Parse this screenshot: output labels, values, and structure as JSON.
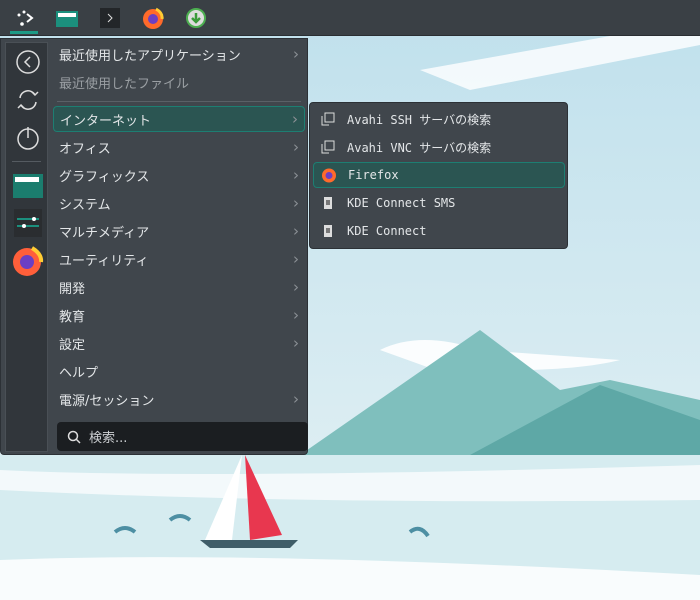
{
  "taskbar": {
    "items": [
      {
        "name": "application-launcher",
        "icon": "kde-launcher-icon"
      },
      {
        "name": "file-manager",
        "icon": "folder-icon"
      },
      {
        "name": "terminal",
        "icon": "terminal-icon"
      },
      {
        "name": "firefox",
        "icon": "firefox-icon"
      },
      {
        "name": "update",
        "icon": "download-icon"
      }
    ]
  },
  "menu": {
    "items": [
      {
        "label": "最近使用したアプリケーション",
        "submenu": true
      },
      {
        "label": "最近使用したファイル",
        "submenu": false
      },
      {
        "label": "インターネット",
        "submenu": true,
        "selected": true
      },
      {
        "label": "オフィス",
        "submenu": true
      },
      {
        "label": "グラフィックス",
        "submenu": true
      },
      {
        "label": "システム",
        "submenu": true
      },
      {
        "label": "マルチメディア",
        "submenu": true
      },
      {
        "label": "ユーティリティ",
        "submenu": true
      },
      {
        "label": "開発",
        "submenu": true
      },
      {
        "label": "教育",
        "submenu": true
      },
      {
        "label": "設定",
        "submenu": true
      },
      {
        "label": "ヘルプ",
        "submenu": false
      },
      {
        "label": "電源/セッション",
        "submenu": true
      }
    ],
    "chevron": "›",
    "search_placeholder": "検索..."
  },
  "submenu": {
    "items": [
      {
        "label": "Avahi SSH サーバの検索",
        "icon": "network-icon"
      },
      {
        "label": "Avahi VNC サーバの検索",
        "icon": "network-icon"
      },
      {
        "label": "Firefox",
        "icon": "firefox-icon",
        "selected": true
      },
      {
        "label": "KDE Connect SMS",
        "icon": "phone-icon"
      },
      {
        "label": "KDE Connect",
        "icon": "phone-icon"
      }
    ]
  },
  "colors": {
    "accent": "#1d9a86",
    "panel": "#3a4045",
    "menu": "#40464c"
  }
}
